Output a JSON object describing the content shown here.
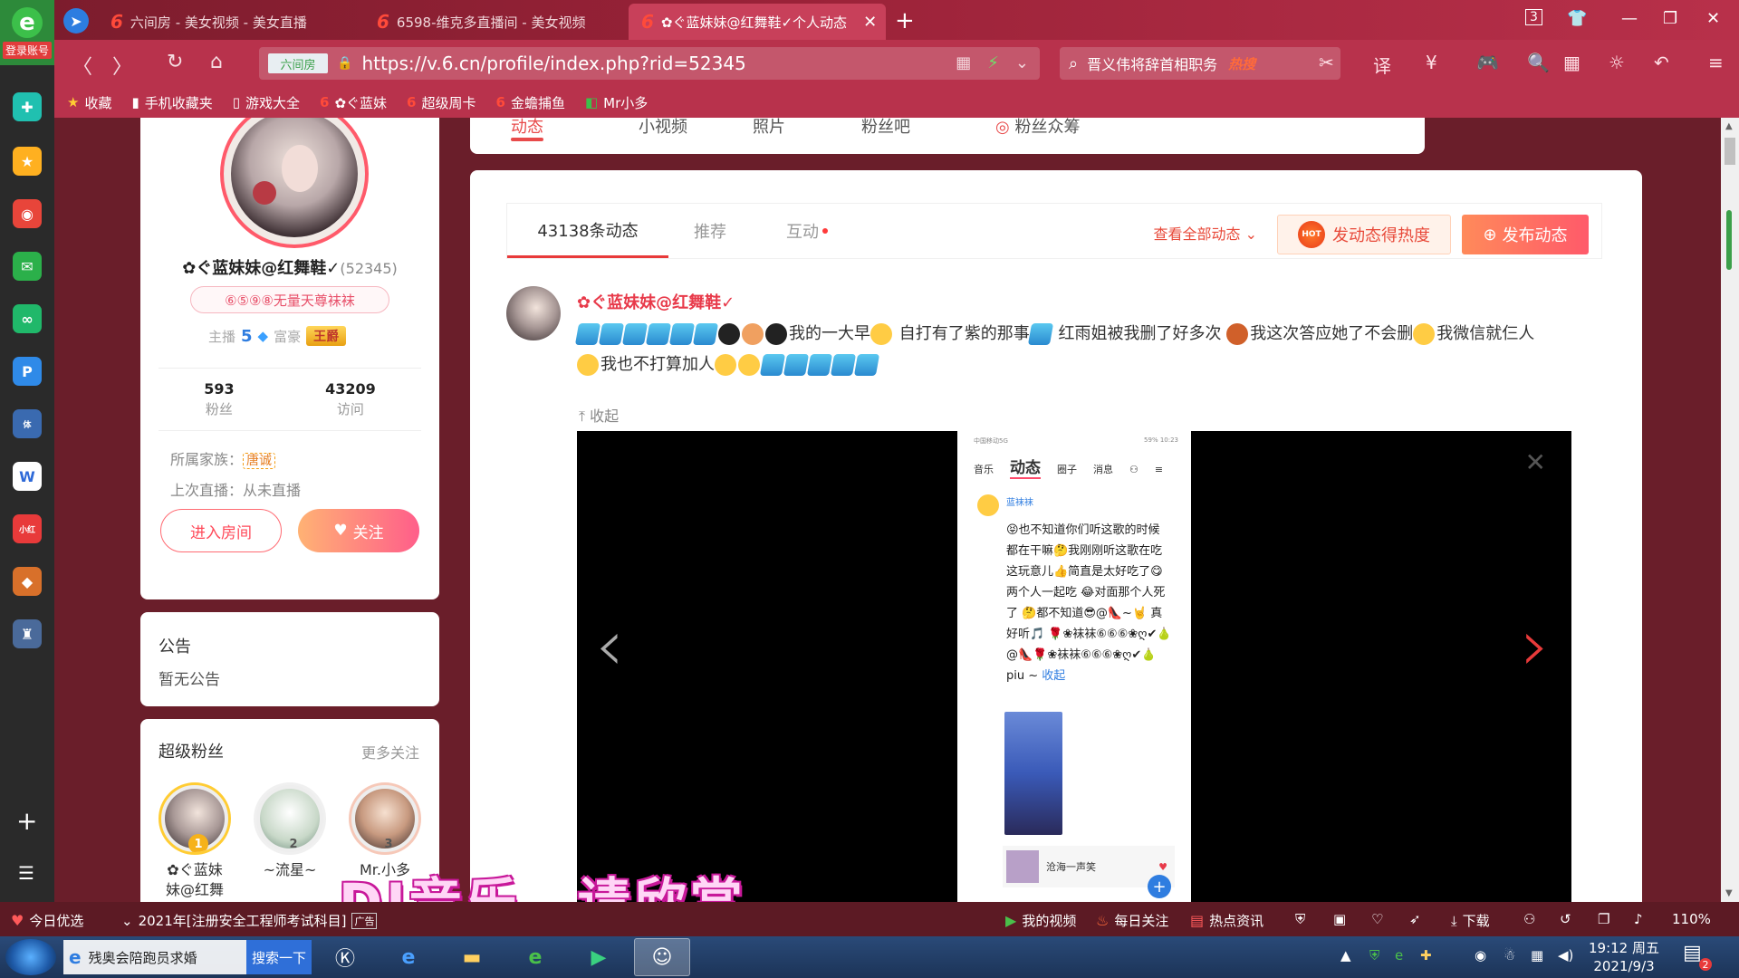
{
  "sidebar": {
    "login_label": "登录账号"
  },
  "tabs": [
    {
      "label": "六间房 - 美女视频 - 美女直播"
    },
    {
      "label": "6598-维克多直播间 - 美女视频"
    },
    {
      "label": "✿ぐ蓝妹妹@红舞鞋✓个人动态"
    }
  ],
  "window": {
    "tab_count": "3"
  },
  "address": {
    "site_tag": "六间房",
    "url": "https://v.6.cn/profile/index.php?rid=52345",
    "search_text": "晋义伟将辞首相职务",
    "search_hot": "热搜"
  },
  "bookmarks": [
    {
      "label": "收藏"
    },
    {
      "label": "手机收藏夹"
    },
    {
      "label": "游戏大全"
    },
    {
      "label": "✿ぐ蓝妹"
    },
    {
      "label": "超级周卡"
    },
    {
      "label": "金蟾捕鱼"
    },
    {
      "label": "Mr小多"
    }
  ],
  "profile": {
    "name": "✿ぐ蓝妹妹@红舞鞋✓",
    "id": "(52345)",
    "family_badge": "⑥⑤⑨⑧无量天尊袜袜",
    "host_label": "主播",
    "host_level": "5",
    "rich_label": "富豪",
    "rich_badge": "王爵",
    "fans_count": "593",
    "fans_label": "粉丝",
    "visits_count": "43209",
    "visits_label": "访问",
    "family_label": "所属家族：",
    "family_name": "唐诚",
    "last_live": "上次直播：从未直播",
    "enter_room": "进入房间",
    "follow": "关注"
  },
  "top_nav": {
    "items": [
      "动态",
      "小视频",
      "照片",
      "粉丝吧",
      "粉丝众筹"
    ]
  },
  "notice": {
    "title": "公告",
    "text": "暂无公告"
  },
  "super_fans": {
    "title": "超级粉丝",
    "more": "更多关注",
    "fans": [
      {
        "rank": "1",
        "name": "✿ぐ蓝妹\n妹@红舞"
      },
      {
        "rank": "2",
        "name": "~流星~"
      },
      {
        "rank": "3",
        "name": "Mr.小多"
      }
    ]
  },
  "feed": {
    "tabs": [
      "43138条动态",
      "推荐",
      "互动"
    ],
    "view_all": "查看全部动态",
    "hot_button": "发动态得热度",
    "post_button": "发布动态",
    "post_author": "✿ぐ蓝妹妹@红舞鞋✓",
    "post_text_1": "我的一大早",
    "post_text_2": "自打有了紫的那事",
    "post_text_3": "红雨姐被我删了好多次",
    "post_text_4": "我这次答应她了不会删",
    "post_text_5": "我微信就仨人",
    "post_text_6": "我也不打算加人",
    "collapse": "收起"
  },
  "phone_screen": {
    "status_left": "中国移动5G",
    "status_right": "59% 10:23",
    "nav": [
      "音乐",
      "动态",
      "圈子",
      "消息"
    ],
    "user": "蓝袜袜",
    "body": "😝也不知道你们听这歌的时候 都在干嘛🤔我刚刚听这歌在吃这玩意儿👍简直是太好吃了😋两个人一起吃 😂对面那个人死了 🤔都不知道😎@👠~🤘 真好听🎵 🌹❀袜袜⑥⑥⑥❀ღ✔🍐@👠🌹❀袜袜⑥⑥⑥❀ღ✔🍐piu ~",
    "more": "收起",
    "song": "沧海一声笑"
  },
  "overlay_subtitle": "DJ音乐，请欣赏",
  "status_bar": {
    "today": "今日优选",
    "news": "2021年[注册安全工程师考试科目]",
    "ad": "广告",
    "my_video": "我的视频",
    "daily": "每日关注",
    "hot_news": "热点资讯",
    "download": "下载",
    "zoom": "110%"
  },
  "taskbar": {
    "ie_text": "残奥会陪跑员求婚",
    "search": "搜索一下",
    "time": "19:12 周五",
    "date": "2021/9/3",
    "notif_count": "2"
  }
}
